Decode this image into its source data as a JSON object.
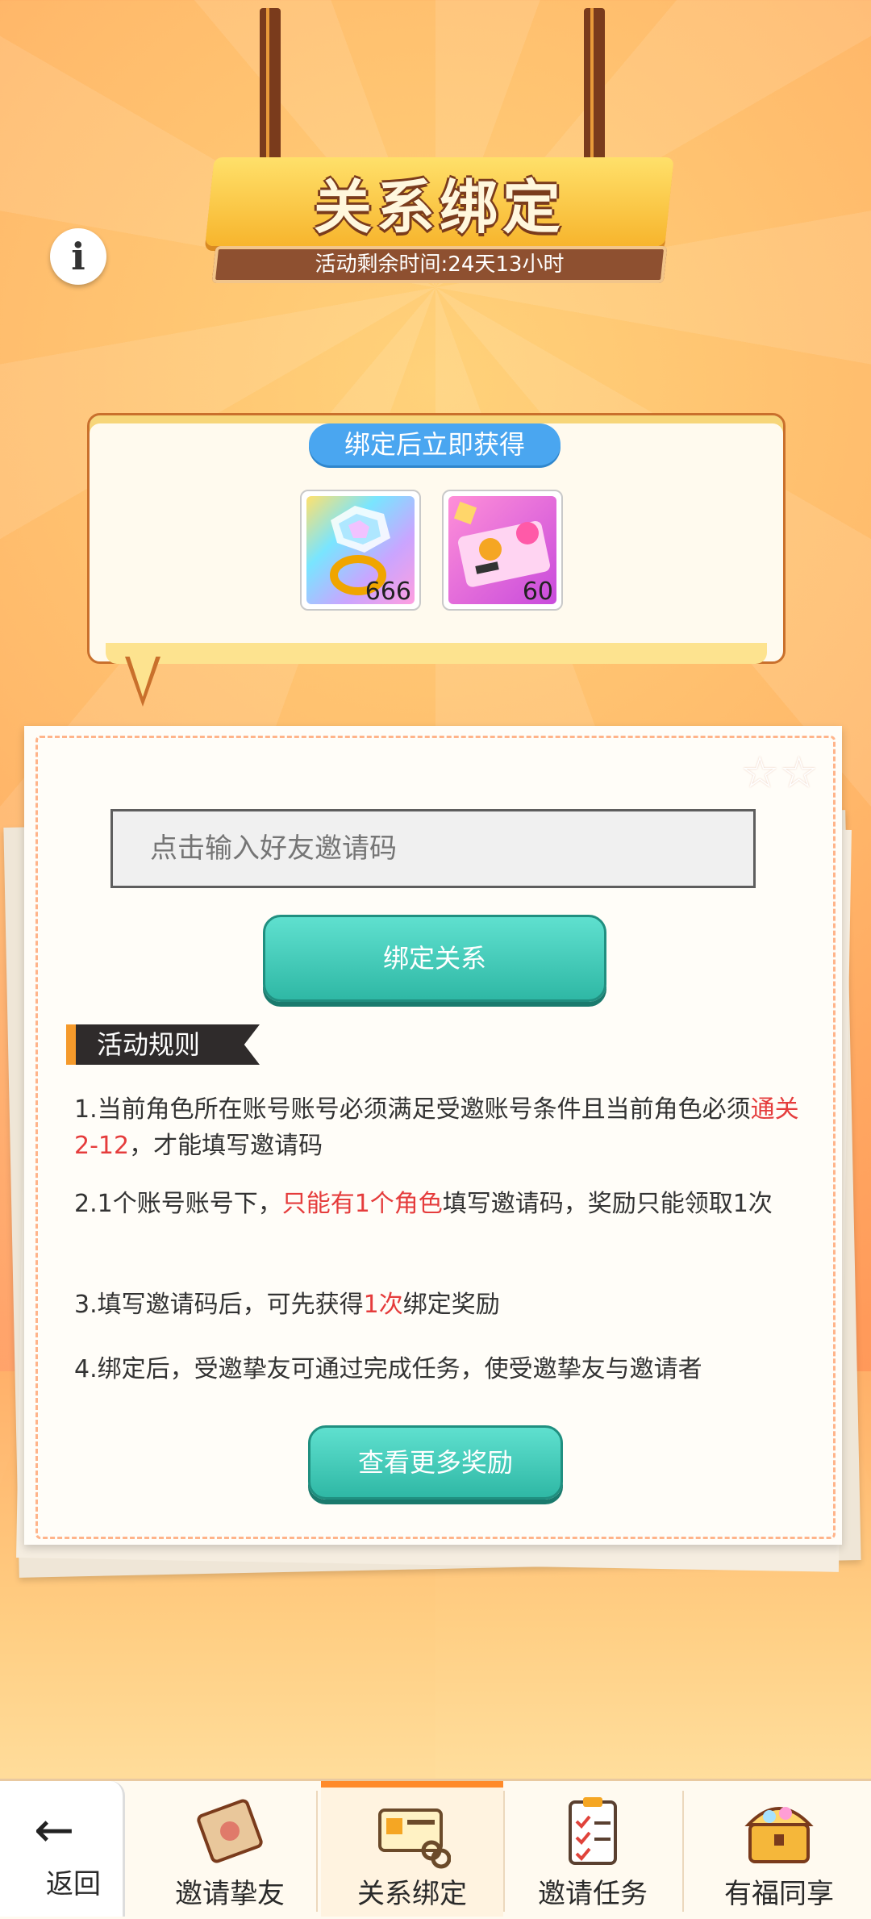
{
  "header": {
    "title": "关系绑定",
    "timer": "活动剩余时间:24天13小时"
  },
  "reward_panel": {
    "heading": "绑定后立即获得",
    "items": [
      {
        "icon": "rainbow-gem-ring-icon",
        "qty": "666"
      },
      {
        "icon": "pink-ticket-icon",
        "qty": "60"
      }
    ]
  },
  "form": {
    "input_placeholder": "点击输入好友邀请码",
    "bind_button": "绑定关系"
  },
  "rules": {
    "title": "活动规则",
    "r1_a": "1.当前角色所在账号账号必须满足受邀账号条件且当前角色必须",
    "r1_hl": "通关2-12",
    "r1_b": "，才能填写邀请码",
    "r2_a": "2.1个账号账号下，",
    "r2_hl": "只能有1个角色",
    "r2_b": "填写邀请码，奖励只能领取1次",
    "r3_a": "3.填写邀请码后，可先获得",
    "r3_hl": "1次",
    "r3_b": "绑定奖励",
    "r4": "4.绑定后，受邀挚友可通过完成任务，使受邀挚友与邀请者",
    "highlight_color": "#e53c3c"
  },
  "more_button": "查看更多奖励",
  "nav": {
    "back_label": "返回",
    "tabs": [
      {
        "label": "邀请挚友",
        "icon": "invitation-letter-icon"
      },
      {
        "label": "关系绑定",
        "icon": "id-card-link-icon",
        "active": true
      },
      {
        "label": "邀请任务",
        "icon": "clipboard-checklist-icon"
      },
      {
        "label": "有福同享",
        "icon": "treasure-chest-icon"
      }
    ],
    "active_color": "#ff8a2a"
  }
}
